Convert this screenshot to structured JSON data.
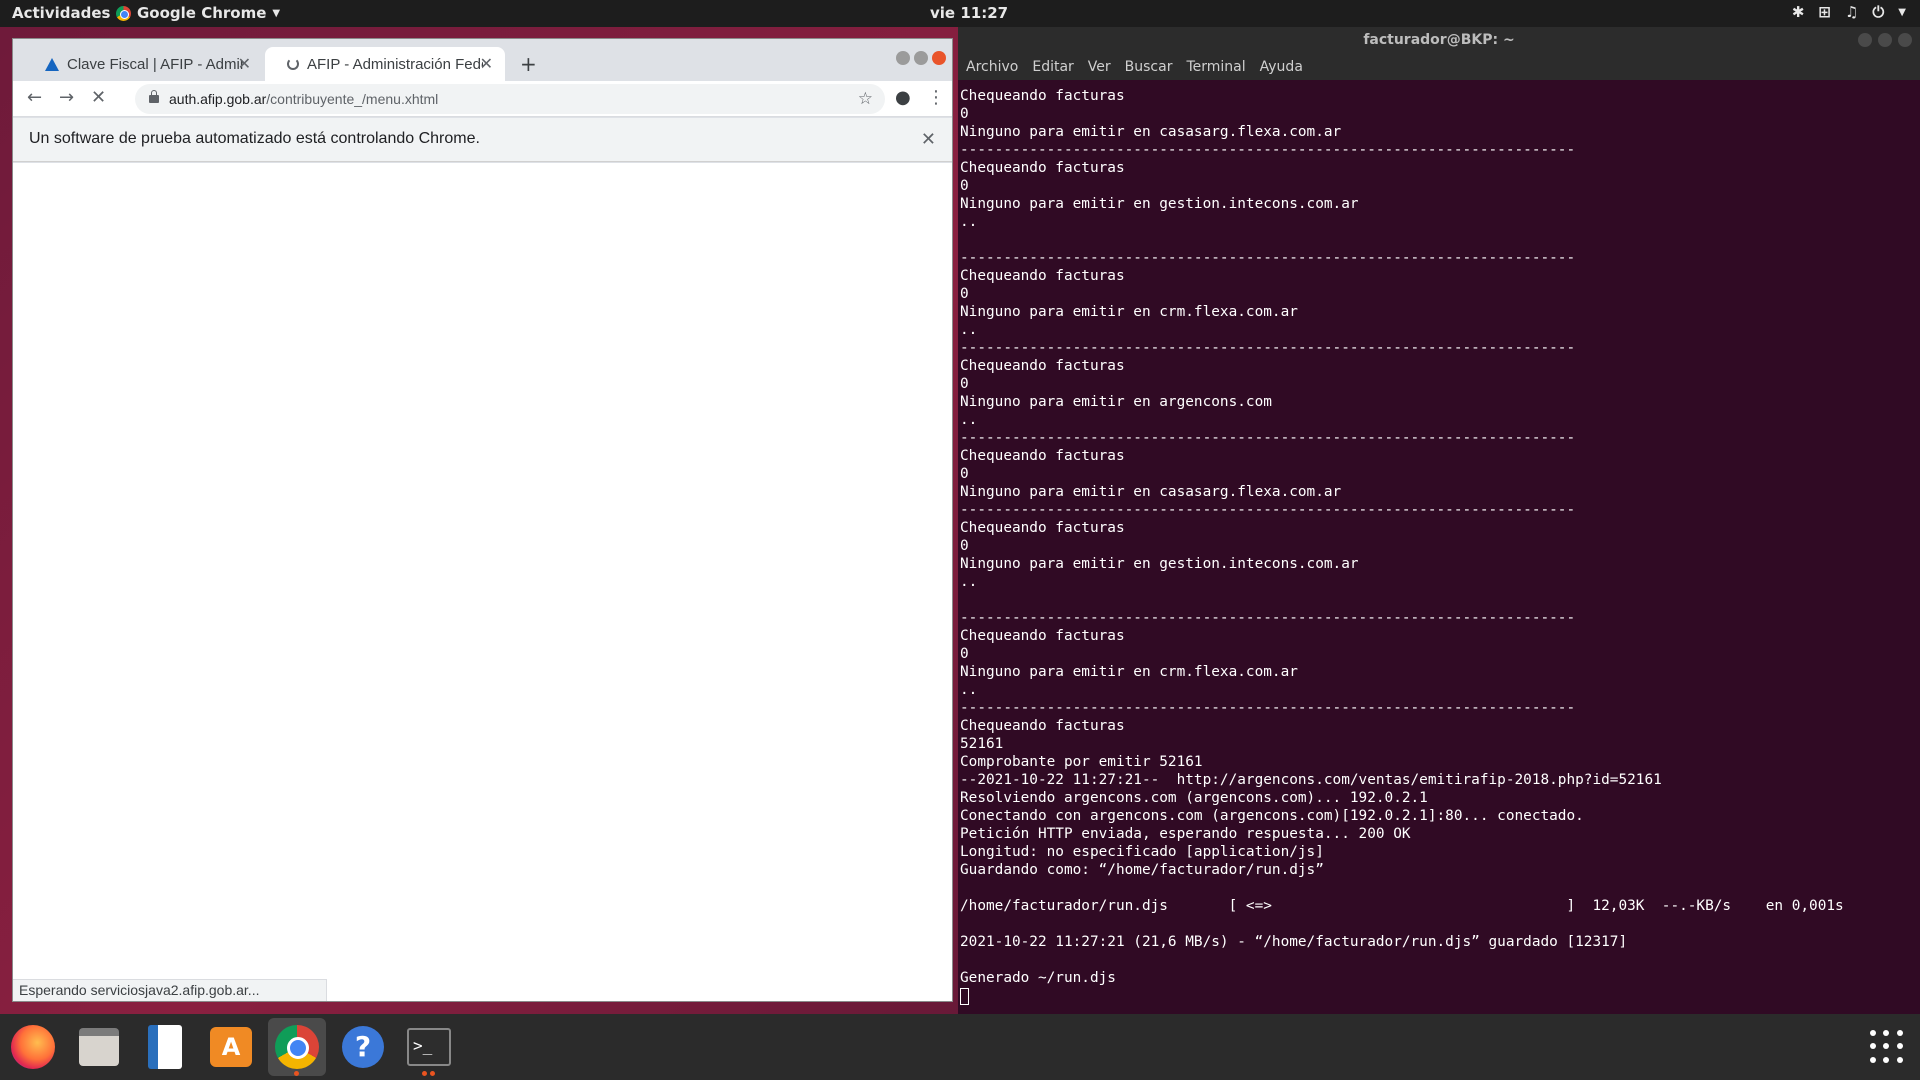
{
  "topbar": {
    "activities": "Actividades",
    "app_name": "Google Chrome",
    "clock": "vie 11:27"
  },
  "chrome": {
    "tabs": [
      {
        "title": "Clave Fiscal | AFIP - Administración Federal",
        "icon": "afip-icon",
        "active": false
      },
      {
        "title": "AFIP - Administración Federal",
        "icon": "loading-spinner-icon",
        "active": true
      }
    ],
    "url": {
      "host": "auth.afip.gob.ar",
      "path": "/contribuyente_/menu.xhtml"
    },
    "infobar": "Un software de prueba automatizado está controlando Chrome.",
    "status": "Esperando serviciosjava2.afip.gob.ar..."
  },
  "terminal": {
    "title": "facturador@BKP: ~",
    "menu": [
      "Archivo",
      "Editar",
      "Ver",
      "Buscar",
      "Terminal",
      "Ayuda"
    ],
    "lines": [
      "Chequeando facturas",
      "0",
      "Ninguno para emitir en casasarg.flexa.com.ar",
      "-----------------------------------------------------------------------",
      "Chequeando facturas",
      "0",
      "Ninguno para emitir en gestion.intecons.com.ar",
      "..",
      "",
      "-----------------------------------------------------------------------",
      "Chequeando facturas",
      "0",
      "Ninguno para emitir en crm.flexa.com.ar",
      "..",
      "-----------------------------------------------------------------------",
      "Chequeando facturas",
      "0",
      "Ninguno para emitir en argencons.com",
      "..",
      "-----------------------------------------------------------------------",
      "Chequeando facturas",
      "0",
      "Ninguno para emitir en casasarg.flexa.com.ar",
      "-----------------------------------------------------------------------",
      "Chequeando facturas",
      "0",
      "Ninguno para emitir en gestion.intecons.com.ar",
      "..",
      "",
      "-----------------------------------------------------------------------",
      "Chequeando facturas",
      "0",
      "Ninguno para emitir en crm.flexa.com.ar",
      "..",
      "-----------------------------------------------------------------------",
      "Chequeando facturas",
      "52161",
      "Comprobante por emitir 52161",
      "--2021-10-22 11:27:21--  http://argencons.com/ventas/emitirafip-2018.php?id=52161",
      "Resolviendo argencons.com (argencons.com)... 192.0.2.1",
      "Conectando con argencons.com (argencons.com)[192.0.2.1]:80... conectado.",
      "Petición HTTP enviada, esperando respuesta... 200 OK",
      "Longitud: no especificado [application/js]",
      "Guardando como: “/home/facturador/run.djs”",
      "",
      "/home/facturador/run.djs       [ <=>                                  ]  12,03K  --.-KB/s    en 0,001s",
      "",
      "2021-10-22 11:27:21 (21,6 MB/s) - “/home/facturador/run.djs” guardado [12317]",
      "",
      "Generado ~/run.djs"
    ]
  },
  "dock": {
    "items": [
      "firefox-icon",
      "files-icon",
      "writer-icon",
      "software-store-icon",
      "chrome-icon",
      "help-icon",
      "terminal-icon"
    ]
  },
  "colors": {
    "terminal_bg": "#300a24",
    "topbar_bg": "#1d1d1d",
    "chrome_frame": "#dee1e6",
    "ubuntu_orange": "#e95420"
  }
}
